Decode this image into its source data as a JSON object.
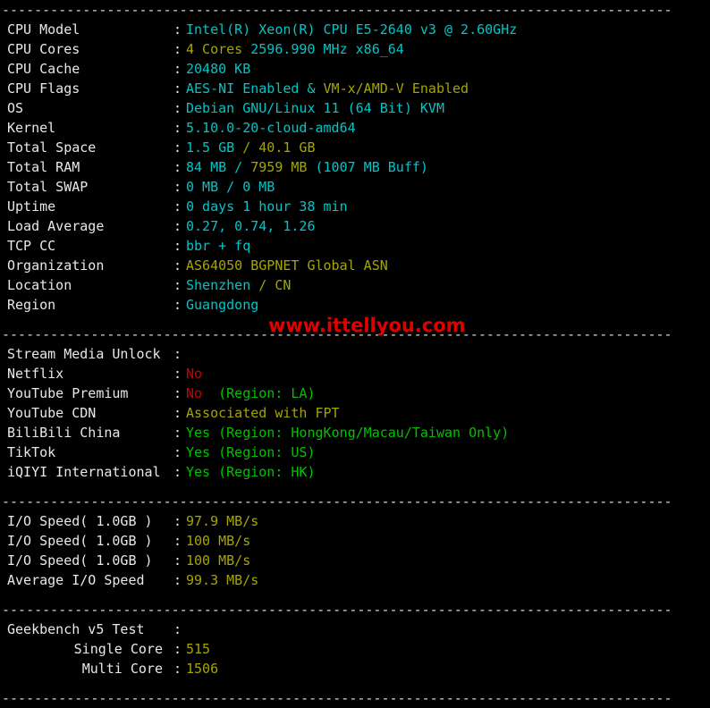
{
  "terminal": {
    "separator": "-----------------------------------------------------------------------------------",
    "colon": ":",
    "watermark": "www.ittellyou.com"
  },
  "system": [
    {
      "label": "CPU Model",
      "parts": [
        {
          "text": "Intel(R) Xeon(R) CPU E5-2640 v3 @ 2.60GHz",
          "color": "cyan"
        }
      ]
    },
    {
      "label": "CPU Cores",
      "parts": [
        {
          "text": "4 Cores ",
          "color": "yellow"
        },
        {
          "text": "2596.990 MHz x86_64",
          "color": "cyan"
        }
      ]
    },
    {
      "label": "CPU Cache",
      "parts": [
        {
          "text": "20480 KB",
          "color": "cyan"
        }
      ]
    },
    {
      "label": "CPU Flags",
      "parts": [
        {
          "text": "AES-NI Enabled & ",
          "color": "cyan"
        },
        {
          "text": "VM-x/AMD-V Enabled",
          "color": "yellow"
        }
      ]
    },
    {
      "label": "OS",
      "parts": [
        {
          "text": "Debian GNU/Linux 11 (64 Bit) KVM",
          "color": "cyan"
        }
      ]
    },
    {
      "label": "Kernel",
      "parts": [
        {
          "text": "5.10.0-20-cloud-amd64",
          "color": "cyan"
        }
      ]
    },
    {
      "label": "Total Space",
      "parts": [
        {
          "text": "1.5 GB ",
          "color": "cyan"
        },
        {
          "text": "/ 40.1 GB",
          "color": "yellow"
        }
      ]
    },
    {
      "label": "Total RAM",
      "parts": [
        {
          "text": "84 MB / ",
          "color": "cyan"
        },
        {
          "text": "7959 MB ",
          "color": "yellow"
        },
        {
          "text": "(1007 MB Buff)",
          "color": "cyan"
        }
      ]
    },
    {
      "label": "Total SWAP",
      "parts": [
        {
          "text": "0 MB / 0 MB",
          "color": "cyan"
        }
      ]
    },
    {
      "label": "Uptime",
      "parts": [
        {
          "text": "0 days 1 hour 38 min",
          "color": "cyan"
        }
      ]
    },
    {
      "label": "Load Average",
      "parts": [
        {
          "text": "0.27, 0.74, 1.26",
          "color": "cyan"
        }
      ]
    },
    {
      "label": "TCP CC",
      "parts": [
        {
          "text": "bbr + fq",
          "color": "cyan"
        }
      ]
    },
    {
      "label": "Organization",
      "parts": [
        {
          "text": "AS64050 BGPNET Global ASN",
          "color": "yellow"
        }
      ]
    },
    {
      "label": "Location",
      "parts": [
        {
          "text": "Shenzhen ",
          "color": "cyan"
        },
        {
          "text": "/ CN",
          "color": "yellow"
        }
      ]
    },
    {
      "label": "Region",
      "parts": [
        {
          "text": "Guangdong",
          "color": "cyan"
        }
      ]
    }
  ],
  "stream": [
    {
      "label": "Stream Media Unlock",
      "parts": []
    },
    {
      "label": "Netflix",
      "parts": [
        {
          "text": "No",
          "color": "red"
        }
      ]
    },
    {
      "label": "YouTube Premium",
      "parts": [
        {
          "text": "No ",
          "color": "red"
        },
        {
          "text": " (Region: LA)",
          "color": "green"
        }
      ]
    },
    {
      "label": "YouTube CDN",
      "parts": [
        {
          "text": "Associated with FPT",
          "color": "yellow"
        }
      ]
    },
    {
      "label": "BiliBili China",
      "parts": [
        {
          "text": "Yes (Region: HongKong/Macau/Taiwan Only)",
          "color": "green"
        }
      ]
    },
    {
      "label": "TikTok",
      "parts": [
        {
          "text": "Yes (Region: US)",
          "color": "green"
        }
      ]
    },
    {
      "label": "iQIYI International",
      "parts": [
        {
          "text": "Yes (Region: HK)",
          "color": "green"
        }
      ]
    }
  ],
  "io": [
    {
      "label": "I/O Speed( 1.0GB )",
      "parts": [
        {
          "text": "97.9 MB/s",
          "color": "yellow"
        }
      ]
    },
    {
      "label": "I/O Speed( 1.0GB )",
      "parts": [
        {
          "text": "100 MB/s",
          "color": "yellow"
        }
      ]
    },
    {
      "label": "I/O Speed( 1.0GB )",
      "parts": [
        {
          "text": "100 MB/s",
          "color": "yellow"
        }
      ]
    },
    {
      "label": "Average I/O Speed",
      "parts": [
        {
          "text": "99.3 MB/s",
          "color": "yellow"
        }
      ]
    }
  ],
  "geekbench": [
    {
      "label": "Geekbench v5 Test",
      "indent": false,
      "parts": []
    },
    {
      "label": "Single Core",
      "indent": true,
      "parts": [
        {
          "text": "515",
          "color": "yellow"
        }
      ]
    },
    {
      "label": "Multi Core",
      "indent": true,
      "parts": [
        {
          "text": "1506",
          "color": "yellow"
        }
      ]
    }
  ]
}
